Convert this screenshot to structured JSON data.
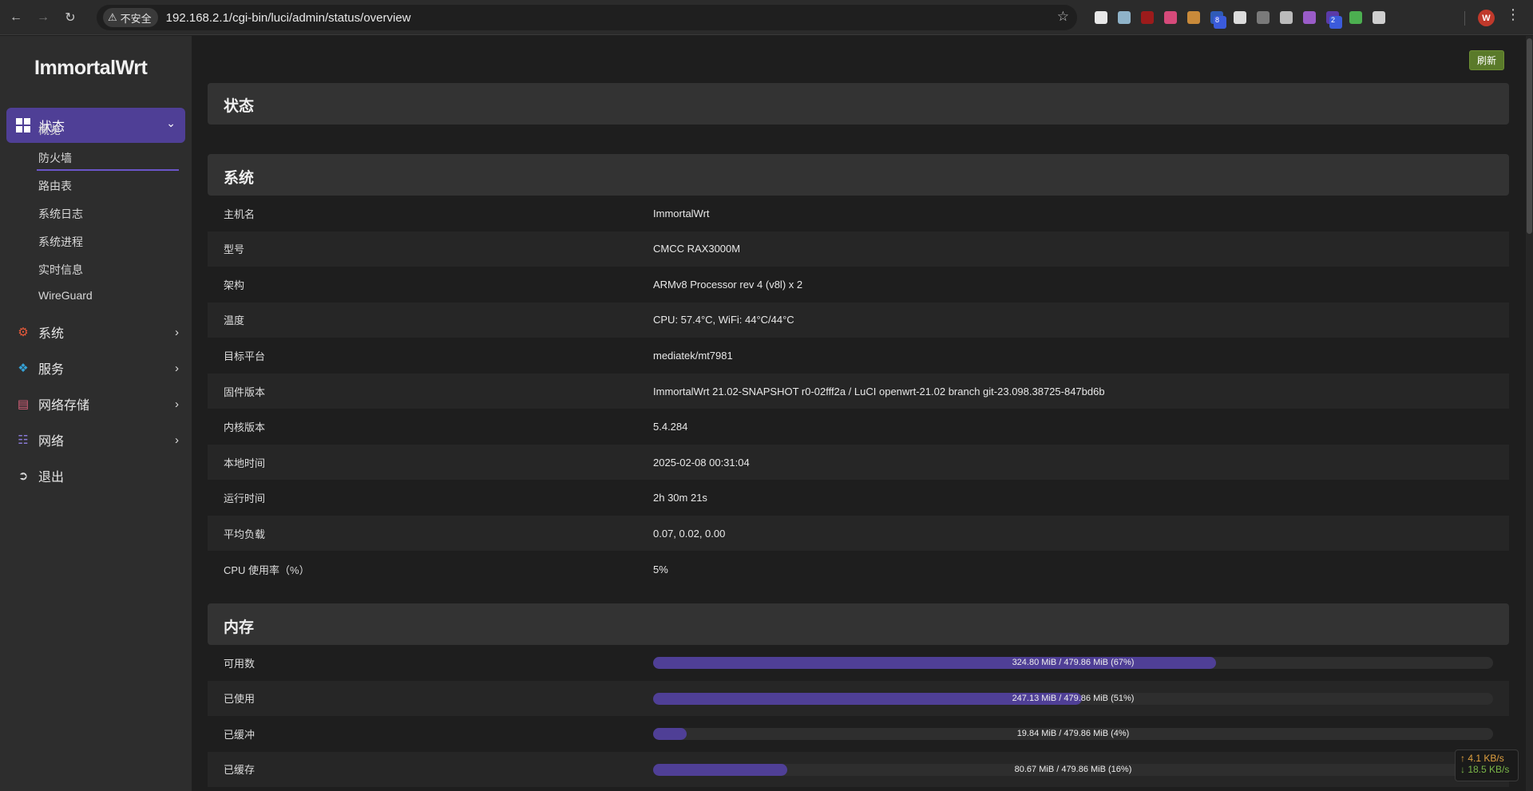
{
  "browser": {
    "security_label": "不安全",
    "url": "192.168.2.1/cgi-bin/luci/admin/status/overview",
    "profile_initial": "W",
    "extensions": [
      {
        "name": "ext-1",
        "color": "#e8e8e8",
        "badge": ""
      },
      {
        "name": "ext-2",
        "color": "#8fb3c9",
        "badge": ""
      },
      {
        "name": "ext-ublock",
        "color": "#9c1b1b",
        "badge": ""
      },
      {
        "name": "ext-translate",
        "color": "#d64a7a",
        "badge": ""
      },
      {
        "name": "ext-cookie",
        "color": "#c98a3a",
        "badge": ""
      },
      {
        "name": "ext-bitwarden",
        "color": "#2f5bb7",
        "badge": "8"
      },
      {
        "name": "ext-6",
        "color": "#dcdcdc",
        "badge": ""
      },
      {
        "name": "ext-7",
        "color": "#7a7a7a",
        "badge": ""
      },
      {
        "name": "ext-8",
        "color": "#bbbbbb",
        "badge": ""
      },
      {
        "name": "ext-9",
        "color": "#9a5cc8",
        "badge": ""
      },
      {
        "name": "ext-10",
        "color": "#5a3aa8",
        "badge": "2"
      },
      {
        "name": "ext-11",
        "color": "#4caf50",
        "badge": ""
      },
      {
        "name": "ext-puzzle",
        "color": "#cfcfcf",
        "badge": ""
      }
    ]
  },
  "sidebar": {
    "logo": "ImmortalWrt",
    "active_menu": "状态",
    "submenu": [
      "概览",
      "防火墙",
      "路由表",
      "系统日志",
      "系统进程",
      "实时信息",
      "WireGuard"
    ],
    "menus": [
      {
        "label": "系统",
        "icon": "gear-icon",
        "color": "#e85a3a"
      },
      {
        "label": "服务",
        "icon": "services-icon",
        "color": "#35a3d8"
      },
      {
        "label": "网络存储",
        "icon": "storage-icon",
        "color": "#d8607a"
      },
      {
        "label": "网络",
        "icon": "network-icon",
        "color": "#8a7ad8"
      },
      {
        "label": "退出",
        "icon": "logout-icon",
        "color": "#dddddd"
      }
    ]
  },
  "main": {
    "refresh_label": "刷新",
    "page_title": "状态",
    "system_title": "系统",
    "system_rows": [
      {
        "k": "主机名",
        "v": "ImmortalWrt"
      },
      {
        "k": "型号",
        "v": "CMCC RAX3000M"
      },
      {
        "k": "架构",
        "v": "ARMv8 Processor rev 4 (v8l) x 2"
      },
      {
        "k": "温度",
        "v": "CPU: 57.4°C, WiFi: 44°C/44°C"
      },
      {
        "k": "目标平台",
        "v": "mediatek/mt7981"
      },
      {
        "k": "固件版本",
        "v": "ImmortalWrt 21.02-SNAPSHOT r0-02fff2a / LuCI openwrt-21.02 branch git-23.098.38725-847bd6b"
      },
      {
        "k": "内核版本",
        "v": "5.4.284"
      },
      {
        "k": "本地时间",
        "v": "2025-02-08 00:31:04"
      },
      {
        "k": "运行时间",
        "v": "2h 30m 21s"
      },
      {
        "k": "平均负载",
        "v": "0.07, 0.02, 0.00"
      },
      {
        "k": "CPU 使用率（%）",
        "v": "5%"
      }
    ],
    "memory_title": "内存",
    "memory_rows": [
      {
        "k": "可用数",
        "v": "324.80 MiB / 479.86 MiB (67%)",
        "fraction": 0.67
      },
      {
        "k": "已使用",
        "v": "247.13 MiB / 479.86 MiB (51%)",
        "fraction": 0.51
      },
      {
        "k": "已缓冲",
        "v": "19.84 MiB / 479.86 MiB (4%)",
        "fraction": 0.04
      },
      {
        "k": "已缓存",
        "v": "80.67 MiB / 479.86 MiB (16%)",
        "fraction": 0.16
      }
    ]
  },
  "speed": {
    "up": "↑ 4.1 KB/s",
    "down": "↓ 18.5 KB/s"
  }
}
